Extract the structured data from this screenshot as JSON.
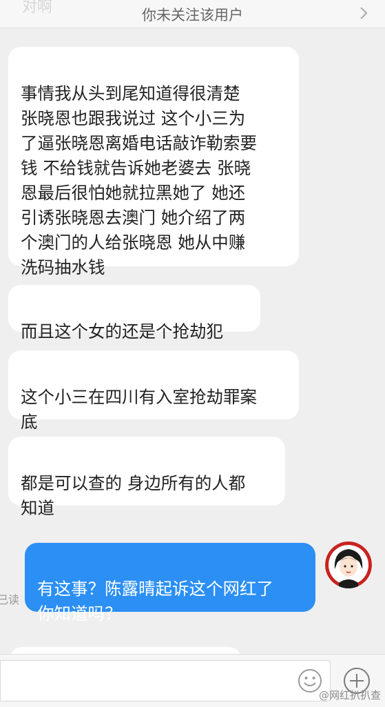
{
  "header": {
    "ghost_text": "对啊",
    "follow_notice": "你未关注该用户"
  },
  "messages": [
    {
      "text": "事情我从头到尾知道得很清楚\n张晓恩也跟我说过 这个小三为\n了逼张晓恩离婚电话敲诈勒索要\n钱 不给钱就告诉她老婆去 张晓\n恩最后很怕她就拉黑她了 她还\n引诱张晓恩去澳门 她介绍了两\n个澳门的人给张晓恩 她从中赚\n洗码抽水钱"
    },
    {
      "text": "而且这个女的还是个抢劫犯"
    },
    {
      "text": "这个小三在四川有入室抢劫罪案\n底"
    },
    {
      "text": "都是可以查的 身边所有的人都\n知道"
    }
  ],
  "outgoing": {
    "text": "有这事？陈露晴起诉这个网红了\n你知道吗？",
    "read_status": "已读"
  },
  "watermark": "@网红扒扒查"
}
